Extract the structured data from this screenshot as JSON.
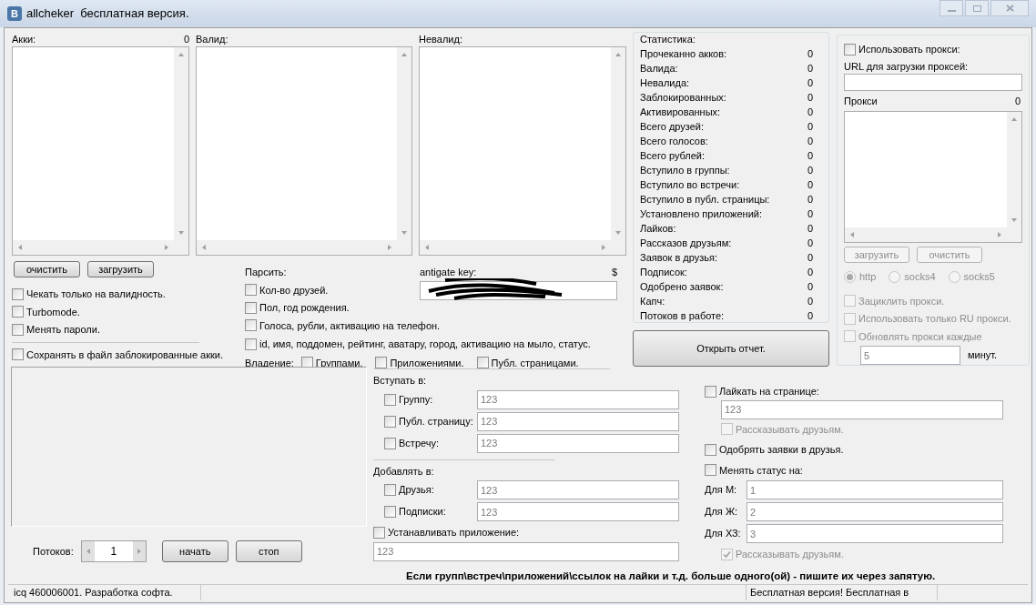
{
  "window": {
    "title": "allcheker  бесплатная версия.",
    "logo": "B"
  },
  "lists": [
    {
      "label": "Акки:",
      "count": "0"
    },
    {
      "label": "Валид:"
    },
    {
      "label": "Невалид:"
    }
  ],
  "list_buttons": [
    "очистить",
    "загрузить"
  ],
  "options": [
    {
      "label": "Чекать только на валидность.",
      "checked": false
    },
    {
      "label": "Turbomode.",
      "checked": false
    },
    {
      "label": "Менять пароли.",
      "checked": false
    }
  ],
  "save_blocked": {
    "label": "Сохранять в файл заблокированные акки.",
    "checked": false
  },
  "parse": {
    "title": "Парсить:",
    "items": [
      {
        "label": "Кол-во друзей.",
        "checked": false
      },
      {
        "label": "Пол, год рождения.",
        "checked": false
      },
      {
        "label": "Голоса, рубли, активацию на телефон.",
        "checked": false
      },
      {
        "label": "id, имя, поддомен, рейтинг, аватару, город, активацию на мыло, статус.",
        "checked": false
      }
    ],
    "ownership_label": "Владение:",
    "ownership": [
      {
        "label": "Группами.",
        "checked": false
      },
      {
        "label": "Приложениями.",
        "checked": false
      },
      {
        "label": "Публ. страницами.",
        "checked": false
      }
    ]
  },
  "antigate": {
    "label": "antigate key:",
    "currency": "$"
  },
  "stats": {
    "title": "Статистика:",
    "rows": [
      {
        "label": "Прочеканно акков:",
        "value": "0"
      },
      {
        "label": "Валида:",
        "value": "0"
      },
      {
        "label": "Невалида:",
        "value": "0"
      },
      {
        "label": "Заблокированных:",
        "value": "0"
      },
      {
        "label": "Активированных:",
        "value": "0"
      },
      {
        "label": "Всего друзей:",
        "value": "0"
      },
      {
        "label": "Всего голосов:",
        "value": "0"
      },
      {
        "label": "Всего рублей:",
        "value": "0"
      },
      {
        "label": "Вступило в группы:",
        "value": "0"
      },
      {
        "label": "Вступило во встречи:",
        "value": "0"
      },
      {
        "label": "Вступило в публ. страницы:",
        "value": "0"
      },
      {
        "label": "Установлено приложений:",
        "value": "0"
      },
      {
        "label": "Лайков:",
        "value": "0"
      },
      {
        "label": "Рассказов друзьям:",
        "value": "0"
      },
      {
        "label": "Заявок в друзья:",
        "value": "0"
      },
      {
        "label": "Подписок:",
        "value": "0"
      },
      {
        "label": "Одобрено заявок:",
        "value": "0"
      },
      {
        "label": "Капч:",
        "value": "0"
      },
      {
        "label": "Потоков в работе:",
        "value": "0"
      }
    ]
  },
  "report_button": "Открыть отчет.",
  "proxy": {
    "use": {
      "label": "Использовать прокси:",
      "checked": false
    },
    "url_label": "URL для загрузки проксей:",
    "list_label": "Прокси",
    "count": "0",
    "disabled": true,
    "buttons": [
      "загрузить",
      "очистить"
    ],
    "types": [
      {
        "label": "http",
        "selected": true
      },
      {
        "label": "socks4",
        "selected": false
      },
      {
        "label": "socks5",
        "selected": false
      }
    ],
    "options": [
      {
        "label": "Зациклить прокси.",
        "checked": false
      },
      {
        "label": "Использовать только RU прокси.",
        "checked": false
      },
      {
        "label": "Обновлять прокси каждые",
        "checked": false
      }
    ],
    "refresh_placeholder": "5",
    "refresh_unit": "минут."
  },
  "join": {
    "title": "Вступать в:",
    "rows": [
      {
        "label": "Группу:",
        "checked": false,
        "placeholder": "123"
      },
      {
        "label": "Публ. страницу:",
        "checked": false,
        "placeholder": "123"
      },
      {
        "label": "Встречу:",
        "checked": false,
        "placeholder": "123"
      }
    ]
  },
  "add": {
    "title": "Добавлять в:",
    "rows": [
      {
        "label": "Друзья:",
        "checked": false,
        "placeholder": "123"
      },
      {
        "label": "Подписки:",
        "checked": false,
        "placeholder": "123"
      }
    ]
  },
  "install_app": {
    "label": "Устанавливать приложение:",
    "checked": false,
    "placeholder": "123"
  },
  "like": {
    "label": "Лайкать на странице:",
    "checked": false,
    "placeholder": "123",
    "tell": {
      "label": "Рассказывать друзьям.",
      "checked": false,
      "disabled": true
    }
  },
  "approve": {
    "label": "Одобрять заявки в друзья.",
    "checked": false
  },
  "status": {
    "label": "Менять статус на:",
    "checked": false,
    "fields": [
      {
        "label": "Для М:",
        "placeholder": "1"
      },
      {
        "label": "Для Ж:",
        "placeholder": "2"
      },
      {
        "label": "Для ХЗ:",
        "placeholder": "3"
      }
    ],
    "tell": {
      "label": "Рассказывать друзьям.",
      "checked": true,
      "disabled": true
    }
  },
  "note": "Если групп\\встреч\\приложений\\ссылок на лайки и т.д. больше одного(ой) - пишите их через запятую.",
  "threads": {
    "label": "Потоков:",
    "value": "1"
  },
  "run_buttons": [
    "начать",
    "стоп"
  ],
  "status_bar": [
    "icq 460006001. Разработка софта.",
    "Бесплатная версия! Бесплатная в"
  ]
}
